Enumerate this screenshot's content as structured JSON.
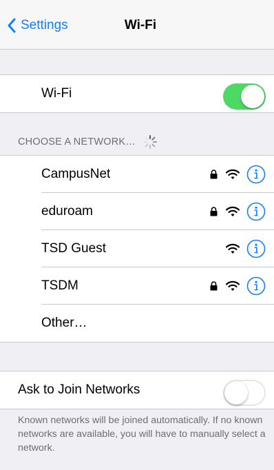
{
  "navbar": {
    "back_label": "Settings",
    "title": "Wi-Fi"
  },
  "wifi": {
    "label": "Wi-Fi",
    "enabled": true
  },
  "networks_header": "CHOOSE A NETWORK…",
  "networks": [
    {
      "name": "CampusNet",
      "secured": true
    },
    {
      "name": "eduroam",
      "secured": true
    },
    {
      "name": "TSD Guest",
      "secured": false
    },
    {
      "name": "TSDM",
      "secured": true
    }
  ],
  "other_label": "Other…",
  "ask_to_join": {
    "label": "Ask to Join Networks",
    "enabled": false
  },
  "footer": "Known networks will be joined automatically. If no known networks are available, you will have to manually select a network.",
  "colors": {
    "accent": "#147efb",
    "toggle_on": "#4cd964",
    "background": "#efeff4"
  }
}
